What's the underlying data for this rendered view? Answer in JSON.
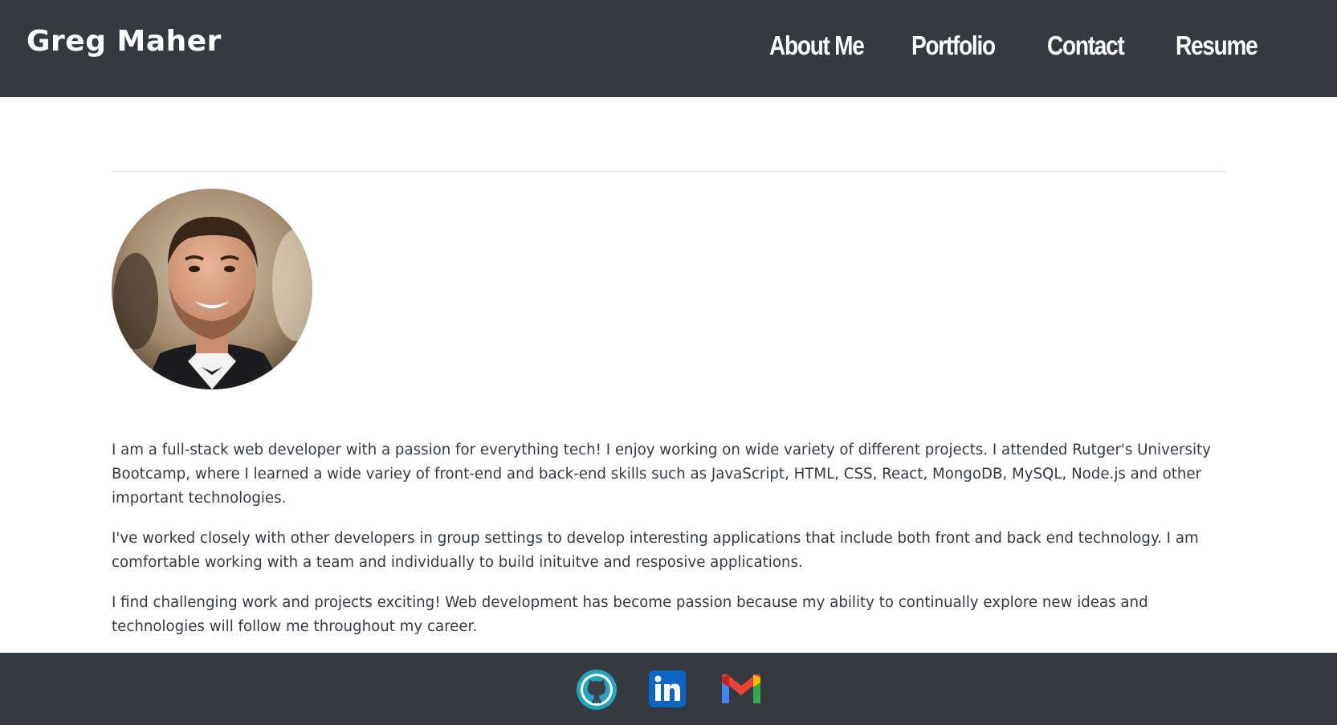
{
  "header": {
    "brand": "Greg Maher",
    "nav": [
      {
        "label": "About Me"
      },
      {
        "label": "Portfolio"
      },
      {
        "label": "Contact"
      },
      {
        "label": "Resume"
      }
    ]
  },
  "main": {
    "paragraphs": [
      "I am a full-stack web developer with a passion for everything tech! I enjoy working on wide variety of different projects. I attended Rutger's University Bootcamp, where I learned a wide variey of front-end and back-end skills such as JavaScript, HTML, CSS, React, MongoDB, MySQL, Node.js and other important technologies.",
      "I've worked closely with other developers in group settings to develop interesting applications that include both front and back end technology. I am comfortable working with a team and individually to build inituitve and resposive applications.",
      "I find challenging work and projects exciting! Web development has become passion because my ability to continually explore new ideas and technologies will follow me throughout my career."
    ]
  },
  "footer": {
    "icons": [
      "github-icon",
      "linkedin-icon",
      "gmail-icon"
    ]
  },
  "colors": {
    "dark": "#343a40",
    "text": "#343a40",
    "github_teal": "#25a4bd",
    "linkedin_blue": "#0a66c2"
  }
}
